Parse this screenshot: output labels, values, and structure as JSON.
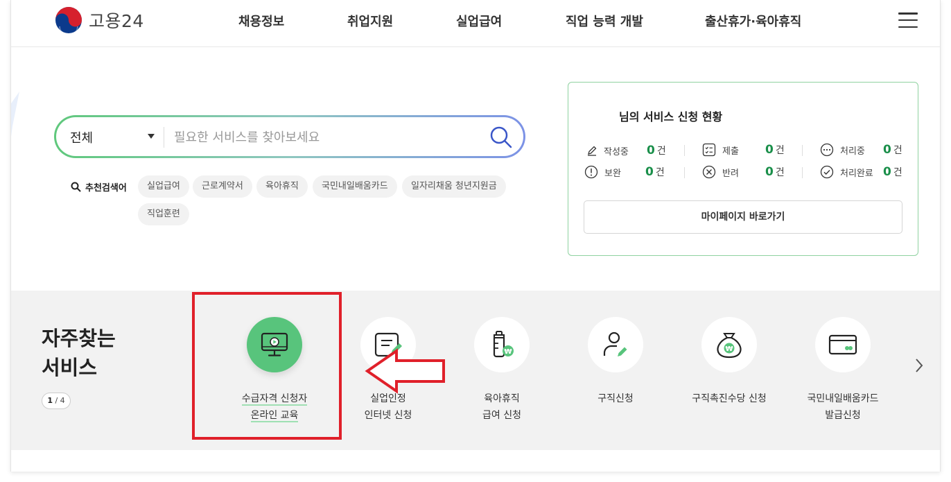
{
  "header": {
    "logo_text": "고용24",
    "nav": [
      "채용정보",
      "취업지원",
      "실업급여",
      "직업 능력 개발",
      "출산휴가·육아휴직"
    ]
  },
  "search": {
    "category": "전체",
    "placeholder": "필요한 서비스를 찾아보세요"
  },
  "recommended": {
    "label": "추천검색어",
    "keywords": [
      "실업급여",
      "근로계약서",
      "육아휴직",
      "국민내일배움카드",
      "일자리채움 청년지원금",
      "직업훈련"
    ]
  },
  "status_card": {
    "title": "님의 서비스 신청 현황",
    "stats": [
      {
        "label": "작성중",
        "count": "0",
        "unit": "건",
        "icon": "pencil-icon"
      },
      {
        "label": "제출",
        "count": "0",
        "unit": "건",
        "icon": "checklist-icon"
      },
      {
        "label": "처리중",
        "count": "0",
        "unit": "건",
        "icon": "ellipsis-icon"
      },
      {
        "label": "보완",
        "count": "0",
        "unit": "건",
        "icon": "exclamation-icon"
      },
      {
        "label": "반려",
        "count": "0",
        "unit": "건",
        "icon": "x-circle-icon"
      },
      {
        "label": "처리완료",
        "count": "0",
        "unit": "건",
        "icon": "check-circle-icon"
      }
    ],
    "mypage_button": "마이페이지 바로가기"
  },
  "services": {
    "title_line1": "자주찾는",
    "title_line2": "서비스",
    "pager_current": "1",
    "pager_total": "4",
    "items": [
      {
        "line1": "수급자격 신청자",
        "line2": "온라인 교육",
        "icon": "monitor-play-icon"
      },
      {
        "line1": "실업인정",
        "line2": "인터넷 신청",
        "icon": "document-edit-icon"
      },
      {
        "line1": "육아휴직",
        "line2": "급여 신청",
        "icon": "baby-bottle-won-icon"
      },
      {
        "line1": "구직신청",
        "line2": "",
        "icon": "person-edit-icon"
      },
      {
        "line1": "구직촉진수당 신청",
        "line2": "",
        "icon": "money-bag-icon"
      },
      {
        "line1": "국민내일배움카드",
        "line2": "발급신청",
        "icon": "card-icon"
      }
    ]
  },
  "colors": {
    "accent_green": "#58c47c",
    "count_green": "#1a8f4a",
    "annotation_red": "#e0202a"
  }
}
